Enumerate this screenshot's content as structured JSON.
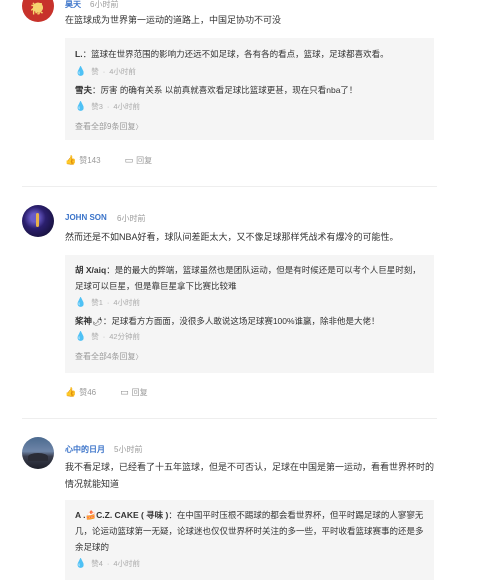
{
  "comments": [
    {
      "author": "昊天",
      "time": "6小时前",
      "text": "在篮球成为世界第一运动的道路上，中国足协功不可没",
      "replies": [
        {
          "name": "L.",
          "text": "：篮球在世界范围的影响力还远不如足球，各有各的看点，篮球，足球都喜欢看。",
          "likes": "赞",
          "time": "4小时前"
        },
        {
          "name": "雪夫",
          "text": "：厉害 的确有关系 以前真就喜欢看足球比篮球更甚，现在只看nba了！",
          "likes": "赞3",
          "time": "4小时前"
        }
      ],
      "view_all": "查看全部9条回复",
      "likes": "赞143",
      "reply_label": "回复"
    },
    {
      "author": "JOHN SON",
      "time": "6小时前",
      "text": "然而还是不如NBA好看，球队间差距太大，又不像足球那样凭战术有爆冷的可能性。",
      "replies": [
        {
          "name": "胡 X/aiq",
          "text": "：是的最大的弊端，篮球虽然也是团队运动，但是有时候还是可以考个人巨星时刻，足球可以巨星，但是靠巨星拿下比赛比较难",
          "likes": "赞1",
          "time": "4小时前"
        },
        {
          "name": "桨神",
          "emoji": "🌶",
          "text": "：足球看方方面面，没很多人敢说这场足球赛100%谁赢，除非他是大佬！",
          "likes": "赞",
          "time": "42分钟前"
        }
      ],
      "view_all": "查看全部4条回复",
      "likes": "赞46",
      "reply_label": "回复"
    },
    {
      "author": "心中的日月",
      "time": "5小时前",
      "text": "我不看足球，已经看了十五年篮球，但是不可否认，足球在中国是第一运动，看看世界杯时的情况就能知道",
      "replies": [
        {
          "name": "A .🍰C.Z. CAKE ( 寻味 )",
          "text": "：在中国平时压根不踢球的都会看世界杯，但平时踢足球的人寥寥无几，论运动篮球第一无疑，论球迷也仅仅世界杯时关注的多一些，平时收看篮球赛事的还是多余足球的",
          "likes": "赞4",
          "time": "4小时前"
        }
      ]
    }
  ],
  "icons": {
    "like": "thumbs-up-icon",
    "reply": "comment-icon",
    "chevron": "chevron-right-icon"
  },
  "colors": {
    "author": "#3a73c9",
    "reply_box": "#f5f5f5",
    "meta": "#999999"
  },
  "chevron_glyph": "〉"
}
